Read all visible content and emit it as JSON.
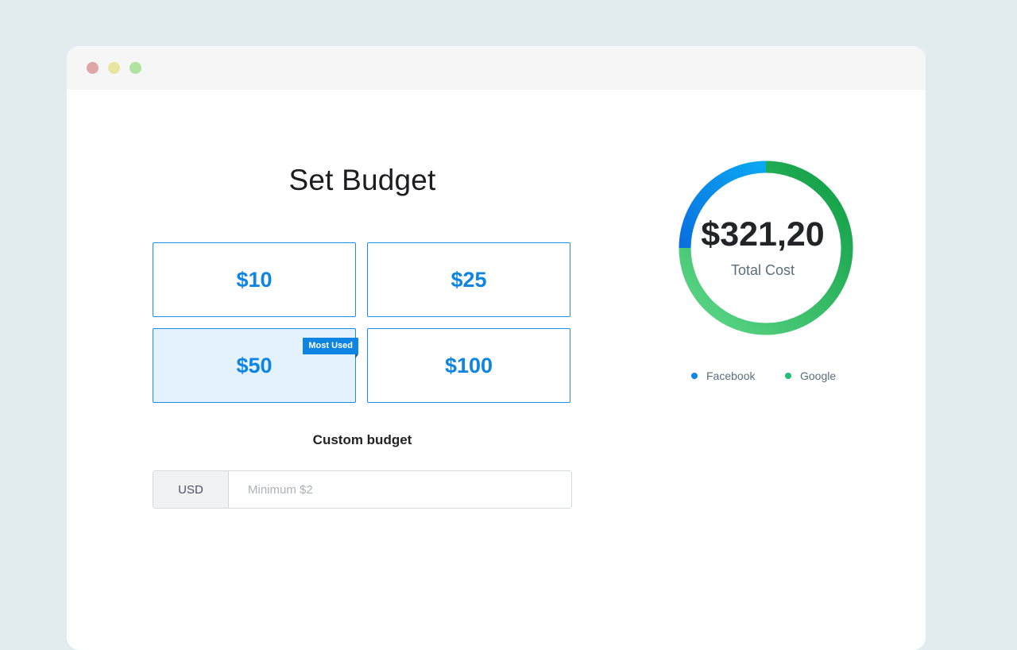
{
  "window": {
    "dots": [
      "close",
      "minimize",
      "maximize"
    ]
  },
  "page": {
    "title": "Set Budget"
  },
  "budget_options": [
    {
      "label": "$10",
      "selected": false
    },
    {
      "label": "$25",
      "selected": false
    },
    {
      "label": "$50",
      "selected": true,
      "badge": "Most Used"
    },
    {
      "label": "$100",
      "selected": false
    }
  ],
  "custom_budget": {
    "label": "Custom budget",
    "currency": "USD",
    "placeholder": "Minimum $2",
    "value": ""
  },
  "summary": {
    "total": "$321,20",
    "total_label": "Total Cost"
  },
  "chart_data": {
    "type": "pie",
    "donut": true,
    "series": [
      {
        "name": "Facebook",
        "share": 0.25,
        "color": "#0e84e3"
      },
      {
        "name": "Google",
        "share": 0.75,
        "color": "#2fbf6a"
      }
    ]
  },
  "legend": [
    {
      "label": "Facebook",
      "color": "#0e84e3"
    },
    {
      "label": "Google",
      "color": "#1dbf73"
    }
  ]
}
